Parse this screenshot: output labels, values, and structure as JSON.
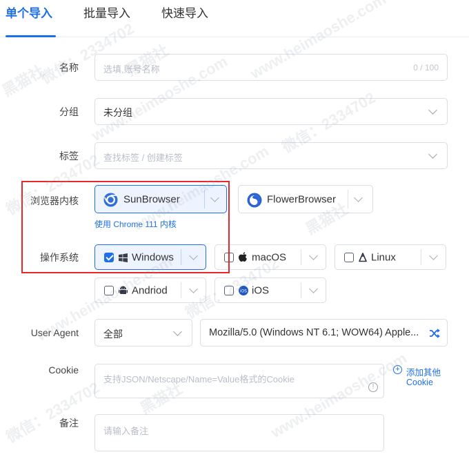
{
  "tabs": [
    {
      "label": "单个导入",
      "active": true
    },
    {
      "label": "批量导入",
      "active": false
    },
    {
      "label": "快速导入",
      "active": false
    }
  ],
  "form": {
    "name": {
      "label": "名称",
      "placeholder": "选填,账号名称",
      "counter": "0 / 100"
    },
    "group": {
      "label": "分组",
      "value": "未分组"
    },
    "tags": {
      "label": "标签",
      "placeholder": "查找标签 / 创建标签"
    },
    "browser_kernel": {
      "label": "浏览器内核",
      "options": [
        {
          "label": "SunBrowser",
          "icon": "chrome-icon",
          "selected": true
        },
        {
          "label": "FlowerBrowser",
          "icon": "firefox-icon",
          "selected": false
        }
      ],
      "hint": "使用 Chrome 111 内核"
    },
    "os": {
      "label": "操作系统",
      "options": [
        {
          "label": "Windows",
          "icon": "windows-icon",
          "checked": true
        },
        {
          "label": "macOS",
          "icon": "apple-icon",
          "checked": false
        },
        {
          "label": "Linux",
          "icon": "linux-icon",
          "checked": false
        },
        {
          "label": "Andriod",
          "icon": "android-icon",
          "checked": false
        },
        {
          "label": "iOS",
          "icon": "ios-icon",
          "checked": false
        }
      ]
    },
    "user_agent": {
      "label": "User Agent",
      "select_value": "全部",
      "value": "Mozilla/5.0 (Windows NT 6.1; WOW64) Apple..."
    },
    "cookie": {
      "label": "Cookie",
      "placeholder": "支持JSON/Netscape/Name=Value格式的Cookie",
      "add_other": "添加其他",
      "add_other_2": "Cookie"
    },
    "remark": {
      "label": "备注",
      "placeholder": "请输入备注"
    }
  },
  "watermark": [
    "黑猫社",
    "微信：2334702",
    "www.heimaoshe.com"
  ],
  "colors": {
    "accent": "#1e6fe8",
    "highlight": "#e8262b"
  }
}
